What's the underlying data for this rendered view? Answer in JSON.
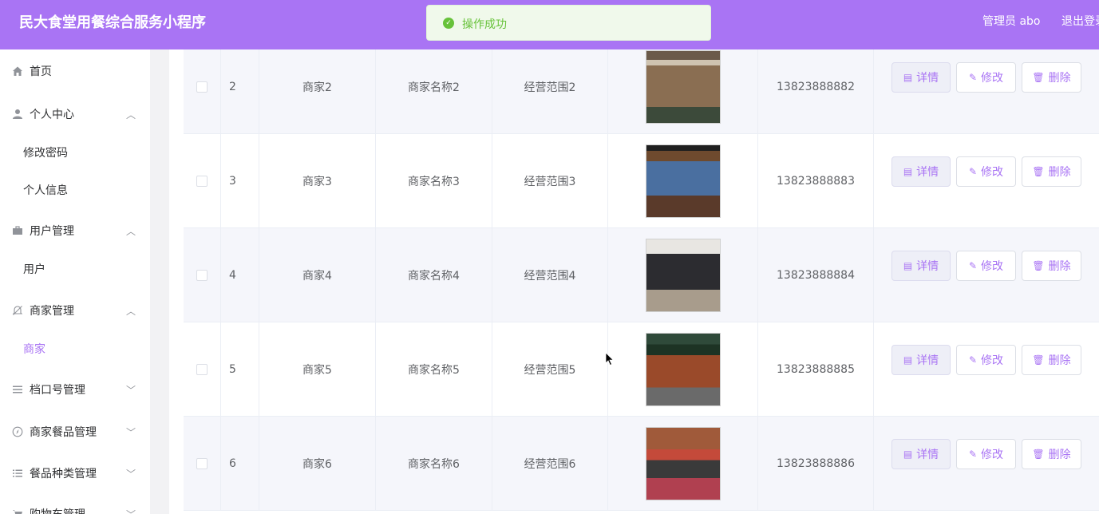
{
  "header": {
    "title": "民大食堂用餐综合服务小程序",
    "user": "管理员 abo",
    "logout": "退出登录"
  },
  "toast": {
    "message": "操作成功"
  },
  "sidebar": {
    "home": "首页",
    "personal_center": "个人中心",
    "change_password": "修改密码",
    "personal_info": "个人信息",
    "user_mgmt": "用户管理",
    "user": "用户",
    "merchant_mgmt": "商家管理",
    "merchant": "商家",
    "stall_mgmt": "档口号管理",
    "meal_mgmt": "商家餐品管理",
    "category_mgmt": "餐品种类管理",
    "cart_mgmt": "购物车管理"
  },
  "actions": {
    "detail": "详情",
    "edit": "修改",
    "delete": "删除"
  },
  "rows": [
    {
      "index": "2",
      "account": "商家2",
      "name": "商家名称2",
      "scope": "经营范围2",
      "phone": "13823888882"
    },
    {
      "index": "3",
      "account": "商家3",
      "name": "商家名称3",
      "scope": "经营范围3",
      "phone": "13823888883"
    },
    {
      "index": "4",
      "account": "商家4",
      "name": "商家名称4",
      "scope": "经营范围4",
      "phone": "13823888884"
    },
    {
      "index": "5",
      "account": "商家5",
      "name": "商家名称5",
      "scope": "经营范围5",
      "phone": "13823888885"
    },
    {
      "index": "6",
      "account": "商家6",
      "name": "商家名称6",
      "scope": "经营范围6",
      "phone": "13823888886"
    }
  ],
  "colors": {
    "accent": "#a974f4",
    "success": "#67c23a"
  }
}
